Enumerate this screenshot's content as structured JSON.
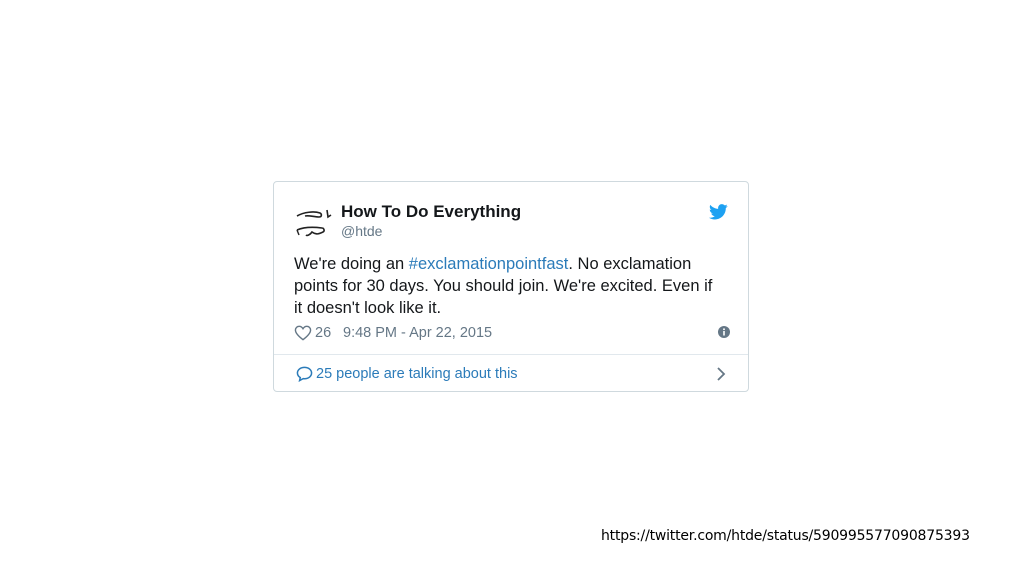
{
  "tweet": {
    "display_name": "How To Do Everything",
    "handle": "@htde",
    "text_before": "We're doing an ",
    "hashtag": "#exclamationpointfast",
    "text_after": ". No exclamation points for 30 days. You should join. We're excited. Even if it doesn't look like it.",
    "like_count": "26",
    "timestamp": "9:48 PM - Apr 22, 2015",
    "conversation_text": "25 people are talking about this"
  },
  "source_url": "https://twitter.com/htde/status/590995577090875393",
  "colors": {
    "link": "#2b7bb9",
    "twitter_blue": "#1da1f2",
    "muted": "#657786",
    "border": "#cfd9de"
  },
  "icons": {
    "avatar": "htde-avatar-icon",
    "brand": "twitter-bird-icon",
    "like": "heart-icon",
    "info": "info-icon",
    "conversation": "speech-bubble-icon",
    "chevron": "chevron-right-icon"
  }
}
